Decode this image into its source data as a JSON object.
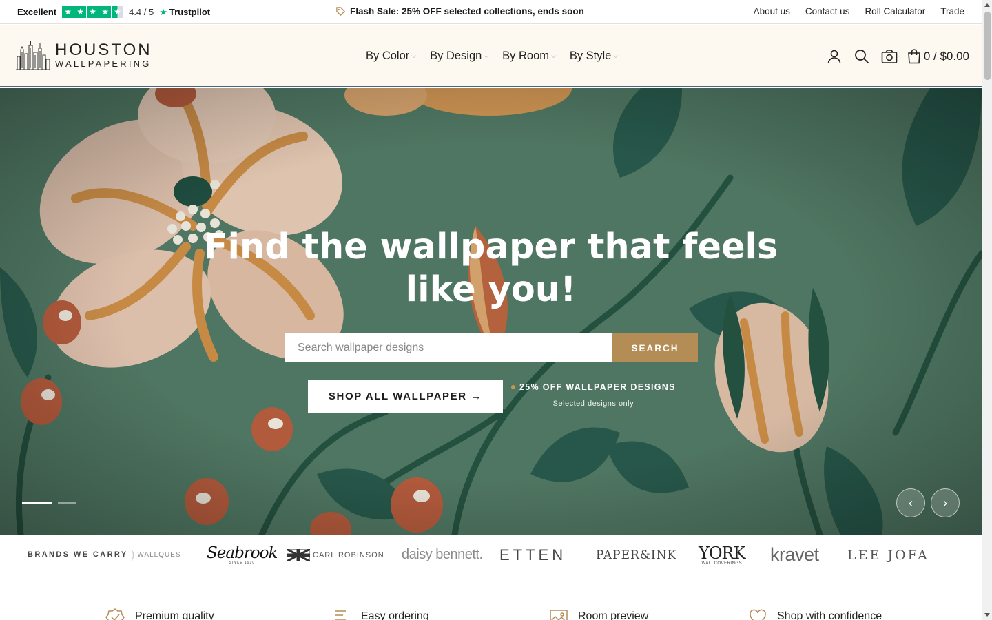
{
  "topbar": {
    "rating_label": "Excellent",
    "rating_score": "4.4 / 5",
    "rating_stars": 4.5,
    "rating_brand": "Trustpilot",
    "flash_sale": "Flash Sale: 25% OFF selected collections, ends soon",
    "links": [
      "About us",
      "Contact us",
      "Roll Calculator",
      "Trade"
    ]
  },
  "header": {
    "logo_line1": "HOUSTON",
    "logo_line2": "WALLPAPERING",
    "nav": [
      "By Color",
      "By Design",
      "By Room",
      "By Style"
    ],
    "cart_total": "0 / $0.00"
  },
  "hero": {
    "title_line1": "Find the wallpaper that feels",
    "title_line2": "like you!",
    "search_placeholder": "Search wallpaper designs",
    "search_button": "SEARCH",
    "shop_button": "SHOP ALL WALLPAPER →",
    "promo_main": "25% OFF WALLPAPER DESIGNS",
    "promo_sub": "Selected designs only",
    "slides": 2,
    "active_slide": 1
  },
  "brands": {
    "label": "BRANDS WE CARRY",
    "items": [
      "WALLQUEST",
      "Seabrook",
      "CARL ROBINSON",
      "daisy bennett.",
      "ETTEN",
      "PAPER&INK",
      "YORK",
      "kravet",
      "LEE JOFA"
    ],
    "york_sub": "WALLCOVERINGS",
    "seabrook_sub": "SINCE 1910"
  },
  "features": [
    "Premium quality",
    "Easy ordering",
    "Room preview",
    "Shop with confidence"
  ],
  "colors": {
    "accent_gold": "#b38d55",
    "hero_green": "#4e7560",
    "header_cream": "#fdf9f1",
    "trustpilot_green": "#00b67a"
  }
}
